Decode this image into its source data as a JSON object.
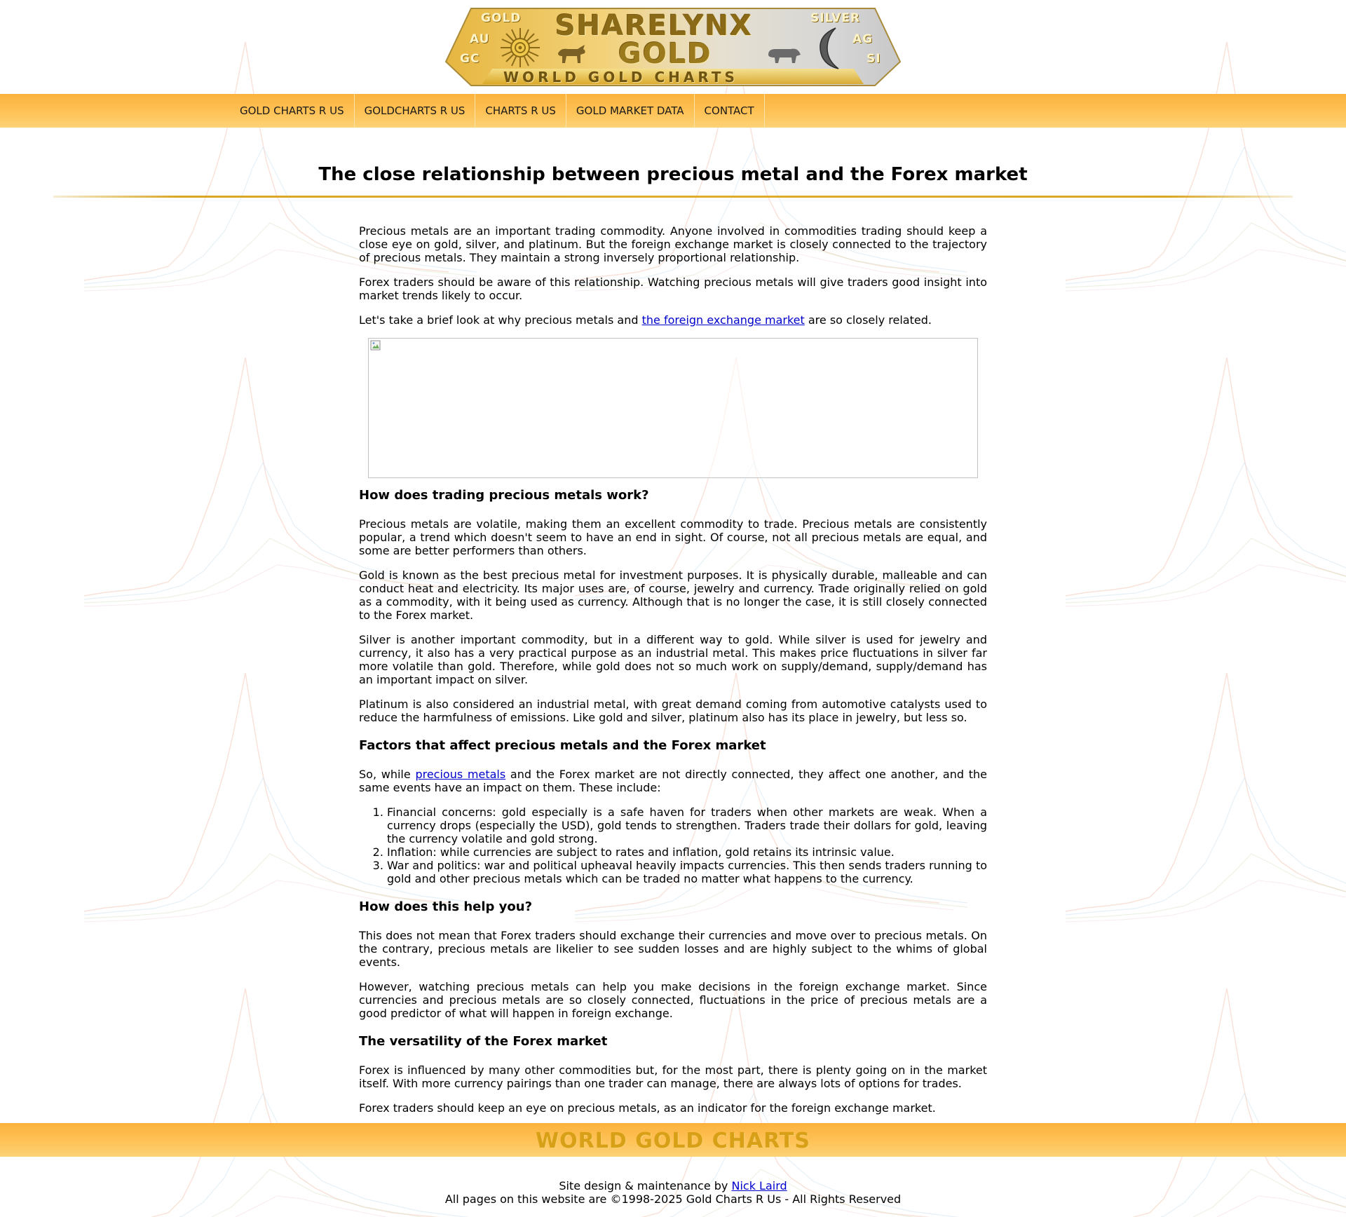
{
  "logo": {
    "brand": "SHARELYNX",
    "gold": "GOLD",
    "subtitle": "WORLD GOLD CHARTS",
    "gold_label": "GOLD",
    "au": "AU",
    "gc": "GC",
    "silver_label": "SILVER",
    "ag": "AG",
    "si": "SI"
  },
  "nav": {
    "items": [
      {
        "label": "GOLD CHARTS R US"
      },
      {
        "label": "GOLDCHARTS R US"
      },
      {
        "label": "CHARTS R US"
      },
      {
        "label": "GOLD MARKET DATA"
      },
      {
        "label": "CONTACT"
      }
    ]
  },
  "article": {
    "title": "The close relationship between precious metal and the Forex market",
    "intro_p1": "Precious metals are an important trading commodity. Anyone involved in commodities trading should keep a close eye on gold, silver, and platinum. But the foreign exchange market is closely connected to the trajectory of precious metals. They maintain a strong inversely proportional relationship.",
    "intro_p2": "Forex traders should be aware of this relationship. Watching precious metals will give traders good insight into market trends likely to occur.",
    "intro_p3_before": "Let's take a brief look at why precious metals and ",
    "intro_p3_link": "the foreign exchange market",
    "intro_p3_after": " are so closely related.",
    "h_trading": "How does trading precious metals work?",
    "trading_p1": "Precious metals are volatile, making them an excellent commodity to trade. Precious metals are consistently popular, a trend which doesn't seem to have an end in sight. Of course, not all precious metals are equal, and some are better performers than others.",
    "trading_p2": "Gold is known as the best precious metal for investment purposes. It is physically durable, malleable and can conduct heat and electricity. Its major uses are, of course, jewelry and currency. Trade originally relied on gold as a commodity, with it being used as currency. Although that is no longer the case, it is still closely connected to the Forex market.",
    "trading_p3": "Silver is another important commodity, but in a different way to gold. While silver is used for jewelry and currency, it also has a very practical purpose as an industrial metal. This makes price fluctuations in silver far more volatile than gold. Therefore, while gold does not so much work on supply/demand, supply/demand has an important impact on silver.",
    "trading_p4": "Platinum is also considered an industrial metal, with great demand coming from automotive catalysts used to reduce the harmfulness of emissions. Like gold and silver, platinum also has its place in jewelry, but less so.",
    "h_factors": "Factors that affect precious metals and the Forex market",
    "factors_before": "So, while ",
    "factors_link": "precious metals",
    "factors_after": " and the Forex market are not directly connected, they affect one another, and the same events have an impact on them. These include:",
    "factors_list": [
      "Financial concerns: gold especially is a safe haven for traders when other markets are weak. When a currency drops (especially the USD), gold tends to strengthen. Traders trade their dollars for gold, leaving the currency volatile and gold strong.",
      "Inflation: while currencies are subject to rates and inflation, gold retains its intrinsic value.",
      "War and politics: war and political upheaval heavily impacts currencies. This then sends traders running to gold and other precious metals which can be traded no matter what happens to the currency."
    ],
    "h_help": "How does this help you?",
    "help_p1": "This does not mean that Forex traders should exchange their currencies and move over to precious metals. On the contrary, precious metals are likelier to see sudden losses and are highly subject to the whims of global events.",
    "help_p2": "However, watching precious metals can help you make decisions in the foreign exchange market. Since currencies and precious metals are so closely connected, fluctuations in the price of precious metals are a good predictor of what will happen in foreign exchange.",
    "h_versatility": "The versatility of the Forex market",
    "vers_p1": "Forex is influenced by many other commodities but, for the most part, there is plenty going on in the market itself. With more currency pairings than one trader can manage, there are always lots of options for trades.",
    "vers_p2": "Forex traders should keep an eye on precious metals, as an indicator for the foreign exchange market."
  },
  "footer": {
    "brand": "WORLD GOLD CHARTS",
    "credit_before": "Site design & maintenance by ",
    "credit_link": "Nick Laird",
    "copyright": "All pages on this website are ©1998-2025 Gold Charts R Us - All Rights Reserved"
  },
  "colors": {
    "nav_bar": "#ffc45a",
    "title_rule": "#d9a624",
    "link": "#0000cc",
    "footer_brand": "#d8a016"
  }
}
